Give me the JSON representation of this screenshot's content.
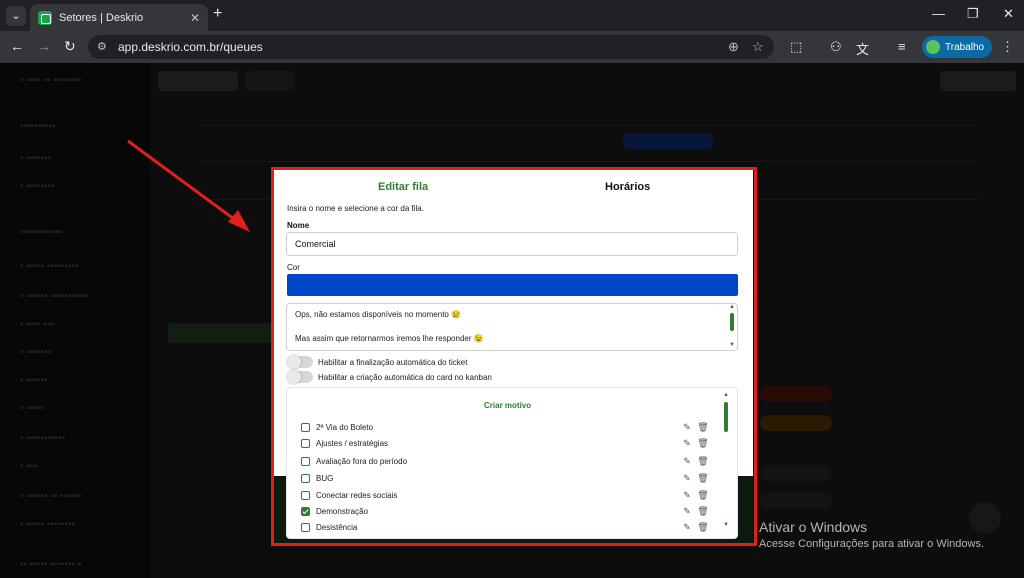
{
  "browser": {
    "tab_title": "Setores | Deskrio",
    "url": "app.deskrio.com.br/queues",
    "profile_label": "Trabalho"
  },
  "modal": {
    "tab_edit": "Editar fila",
    "tab_hours": "Horários",
    "intro": "Insira o nome e selecione a cor da fila.",
    "name_label": "Nome",
    "name_value": "Comercial",
    "color_label": "Cor",
    "color_value": "#0047c7",
    "message_lines": [
      "Ops, não estamos disponíveis no momento 😢",
      "Mas assim que retornarmos iremos lhe responder 😉"
    ],
    "toggles": [
      {
        "label": "Habilitar a finalização automática do ticket",
        "on": false
      },
      {
        "label": "Habilitar a criação automática do card no kanban",
        "on": false
      }
    ],
    "create_reason_label": "Criar motivo",
    "reasons": [
      {
        "label": "2ª Via do Boleto",
        "checked": false
      },
      {
        "label": "Ajustes / estratégias",
        "checked": false
      },
      {
        "label": "Avaliação fora do período",
        "checked": false
      },
      {
        "label": "BUG",
        "checked": false
      },
      {
        "label": "Conectar redes sociais",
        "checked": false
      },
      {
        "label": "Demonstração",
        "checked": true
      },
      {
        "label": "Desistência",
        "checked": false
      }
    ]
  },
  "windows_watermark": {
    "line1": "Ativar o Windows",
    "line2": "Acesse Configurações para ativar o Windows."
  },
  "annotation_color": "#e0201c"
}
